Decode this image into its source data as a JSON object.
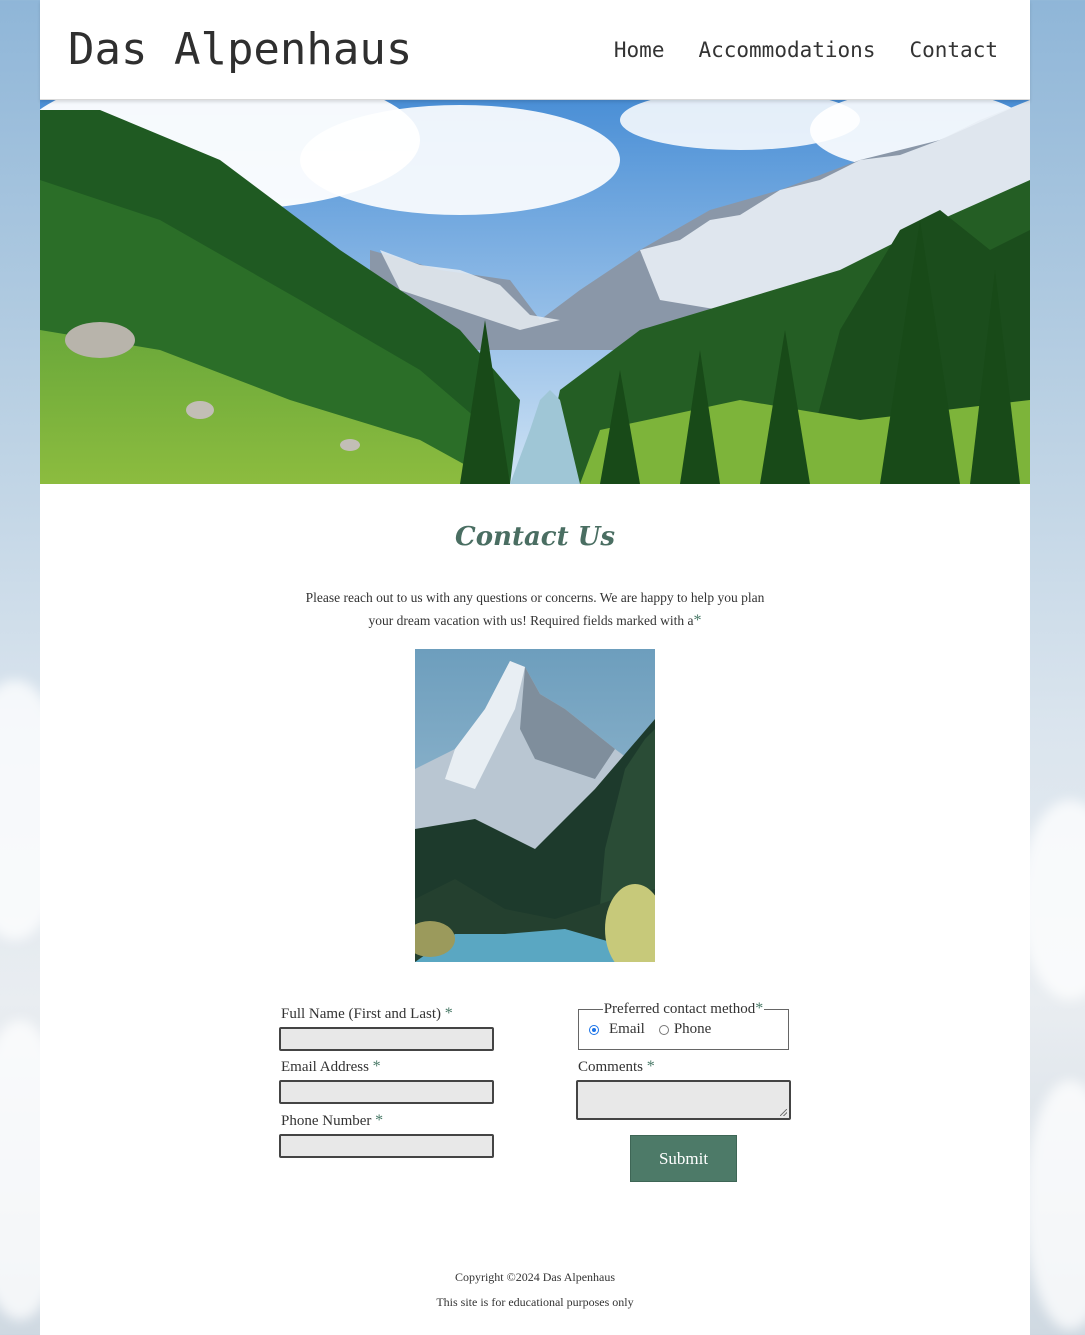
{
  "site": {
    "title": "Das Alpenhaus"
  },
  "nav": {
    "items": [
      {
        "label": "Home"
      },
      {
        "label": "Accommodations"
      },
      {
        "label": "Contact"
      }
    ]
  },
  "main": {
    "heading": "Contact Us",
    "intro": "Please reach out to us with any questions or concerns. We are happy to help you plan your dream vacation with us! Required fields marked with a",
    "required_marker": "*"
  },
  "form": {
    "full_name_label": "Full Name (First and Last)",
    "email_label": "Email Address",
    "phone_label": "Phone Number",
    "contact_method_legend": "Preferred contact method",
    "contact_options": [
      {
        "label": "Email",
        "checked": true
      },
      {
        "label": "Phone",
        "checked": false
      }
    ],
    "comments_label": "Comments",
    "submit_label": "Submit",
    "full_name_value": "",
    "email_value": "",
    "phone_value": "",
    "comments_value": ""
  },
  "footer": {
    "copyright": "Copyright ©2024 Das Alpenhaus",
    "note": "This site is for educational purposes only"
  },
  "colors": {
    "accent": "#4d7a68",
    "heading": "#4a6e62"
  }
}
